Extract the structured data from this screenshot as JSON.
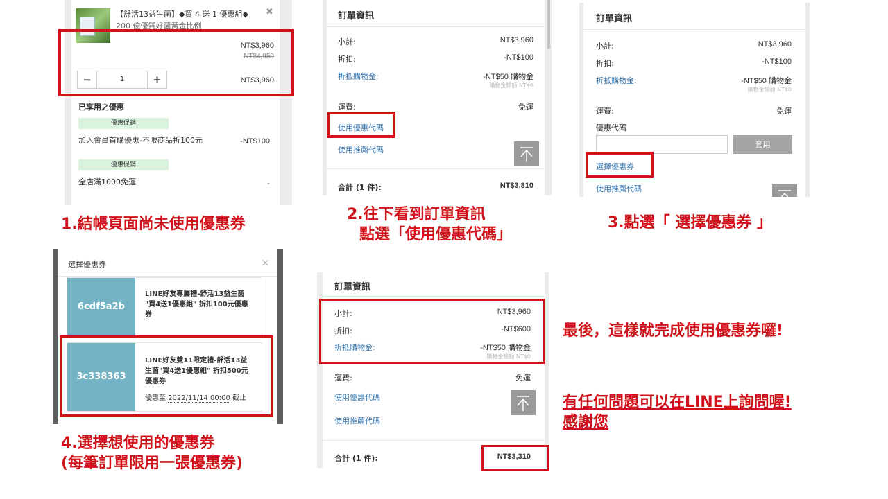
{
  "p1": {
    "product_name_l1": "【舒活13益生菌】◆買 4 送 1 優惠組◆",
    "product_name_l2": "200 億優質好菌黃金比例",
    "close": "✖",
    "price": "NT$3,960",
    "orig_price": "NT$4,950",
    "minus": "−",
    "qty": "1",
    "plus": "+",
    "line_total": "NT$3,960",
    "applied_title": "已享用之優惠",
    "tag1": "優惠促銷",
    "promo1": "加入會員首購優惠-不限商品折100元",
    "promo1_amt": "-NT$100",
    "tag2": "優惠促銷",
    "promo2": "全店滿1000免運",
    "promo2_amt": "-"
  },
  "caption1_num": "1.",
  "caption1_text": "結帳頁面尚未使用優惠券",
  "p2": {
    "title": "訂單資訊",
    "subtotal_label": "小計:",
    "subtotal": "NT$3,960",
    "discount_label": "折扣:",
    "discount": "-NT$100",
    "points_label": "折抵購物金:",
    "points": "-NT$50 購物金",
    "points_note": "購物金餘額 NT$0",
    "shipping_label": "運費:",
    "shipping": "免運",
    "coupon_code": "使用優惠代碼",
    "referral_code": "使用推薦代碼",
    "total_label": "合計 (1 件):",
    "total": "NT$3,810"
  },
  "caption2_num": "2.",
  "caption2_l1": "往下看到訂單資訊",
  "caption2_l2": "點選「使用優惠代碼」",
  "p3": {
    "title": "訂單資訊",
    "subtotal_label": "小計:",
    "subtotal": "NT$3,960",
    "discount_label": "折扣:",
    "discount": "-NT$100",
    "points_label": "折抵購物金:",
    "points": "-NT$50 購物金",
    "points_note": "購物金餘額 NT$0",
    "shipping_label": "運費:",
    "shipping": "免運",
    "code_label": "優惠代碼",
    "apply": "套用",
    "select_coupon": "選擇優惠券",
    "referral_code": "使用推薦代碼"
  },
  "caption3_num": "3.",
  "caption3_text": "點選「 選擇優惠券 」",
  "p4": {
    "title": "選擇優惠券",
    "close": "×",
    "c1_code": "6cdf5a2b",
    "c1_l1": "LINE好友專屬禮-舒活13益生菌",
    "c1_l2": "\"買4送1優惠組\" 折扣100元優惠",
    "c1_l3": "券",
    "c2_code": "3c338363",
    "c2_l1": "LINE好友雙11限定禮-舒活13益",
    "c2_l2": "生菌\"買4送1優惠組\" 折扣500元",
    "c2_l3": "優惠券",
    "c2_until_prefix": "優惠至",
    "c2_until_date": "2022/11/14 00:00",
    "c2_until_suffix": "截止"
  },
  "caption4_num": "4.",
  "caption4_l1": "選擇想使用的優惠券",
  "caption4_l2": "(每筆訂單限用一張優惠券)",
  "p5": {
    "title": "訂單資訊",
    "subtotal_label": "小計:",
    "subtotal": "NT$3,960",
    "discount_label": "折扣:",
    "discount": "-NT$600",
    "points_label": "折抵購物金:",
    "points": "-NT$50 購物金",
    "points_note": "購物金餘額 NT$0",
    "shipping_label": "運費:",
    "shipping": "免運",
    "coupon_code": "使用優惠代碼",
    "referral_code": "使用推薦代碼",
    "total_label": "合計 (1 件):",
    "total": "NT$3,310"
  },
  "final_l1": "最後，這樣就完成使用優惠券囉!",
  "final_l2": "有任何問題可以在LINE上詢問喔!",
  "final_l3": "感謝您",
  "colors": {
    "red": "#d0121b",
    "link_blue": "#3a7ab3",
    "coupon_teal": "#73b3c4",
    "promo_green": "#d9f3de"
  }
}
